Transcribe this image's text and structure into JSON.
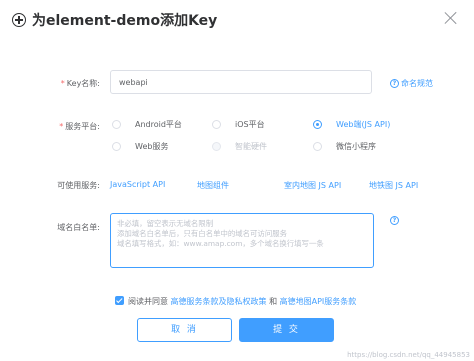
{
  "dialog": {
    "title": "为element-demo添加Key"
  },
  "form": {
    "key_name": {
      "label": "Key名称:",
      "value": "webapi",
      "help_text": "命名规范"
    },
    "platform": {
      "label": "服务平台:",
      "options": [
        {
          "label": "Android平台",
          "checked": false,
          "disabled": false
        },
        {
          "label": "iOS平台",
          "checked": false,
          "disabled": false
        },
        {
          "label": "Web端(JS API)",
          "checked": true,
          "disabled": false
        },
        {
          "label": "Web服务",
          "checked": false,
          "disabled": false
        },
        {
          "label": "智能硬件",
          "checked": false,
          "disabled": true
        },
        {
          "label": "微信小程序",
          "checked": false,
          "disabled": false
        }
      ]
    },
    "services": {
      "label": "可使用服务:",
      "items": [
        "JavaScript API",
        "地图组件",
        "室内地图 JS API",
        "地铁图 JS API"
      ]
    },
    "whitelist": {
      "label": "域名白名单:",
      "placeholder_lines": [
        "非必填，留空表示无域名限制",
        "添加域名白名单后，只有白名单中的域名可访问服务",
        "域名填写格式，如：www.amap.com，多个域名换行填写一条"
      ]
    },
    "agreement": {
      "prefix": "阅读并同意",
      "link1": "高德服务条款及隐私权政策",
      "conj": "和",
      "link2": "高德地图API服务条款",
      "checked": true
    }
  },
  "buttons": {
    "cancel": "取 消",
    "submit": "提 交"
  },
  "watermark": "https://blog.csdn.net/qq_44945853",
  "colors": {
    "accent": "#409eff",
    "required": "#f56c6c",
    "text": "#606266"
  }
}
